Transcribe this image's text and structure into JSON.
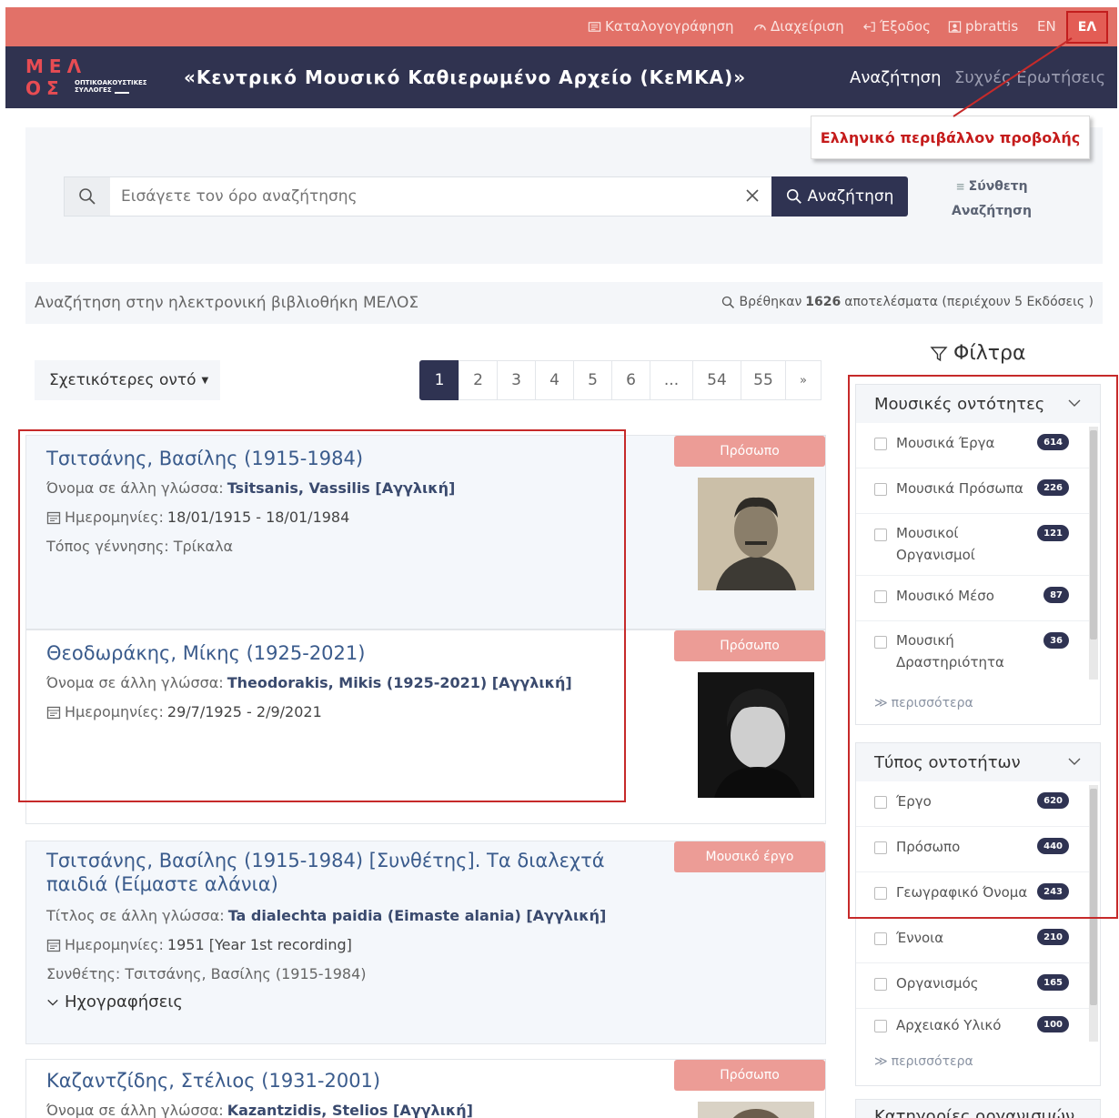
{
  "topbar": {
    "items": [
      {
        "label": "Καταλογογράφηση",
        "icon": "catalog-icon"
      },
      {
        "label": "Διαχείριση",
        "icon": "dashboard-icon"
      },
      {
        "label": "Έξοδος",
        "icon": "logout-icon"
      },
      {
        "label": "pbrattis",
        "icon": "user-icon"
      }
    ],
    "lang_en": "EN",
    "lang_el": "ΕΛ"
  },
  "header": {
    "logo": {
      "letters_top": "ΜΕΛ",
      "letters_bottom": "ΟΣ",
      "subtitle_line1": "ΟΠΤΙΚΟΑΚΟΥΣΤΙΚΕΣ",
      "subtitle_line2": "ΣΥΛΛΟΓΕΣ"
    },
    "title": "«Κεντρικό Μουσικό Καθιερωμένο Αρχείο (ΚεΜΚΑ)»",
    "nav_search": "Αναζήτηση",
    "nav_faq": "Συχνές Ερωτήσεις"
  },
  "callout": "Ελληνικό περιβάλλον προβολής",
  "search": {
    "placeholder": "Εισάγετε τον όρο αναζήτησης",
    "button": "Αναζήτηση",
    "advanced_line1": "Σύνθετη",
    "advanced_line2": "Αναζήτηση"
  },
  "info": {
    "left": "Αναζήτηση στην ηλεκτρονική βιβλιοθήκη ΜΕΛΟΣ",
    "found_prefix": "Βρέθηκαν",
    "found_count": "1626",
    "found_suffix": "αποτελέσματα (περιέχουν 5 Εκδόσεις )"
  },
  "sort": {
    "label": "Σχετικότερες οντό"
  },
  "pagination": {
    "pages": [
      "1",
      "2",
      "3",
      "4",
      "5",
      "6",
      "...",
      "54",
      "55",
      "»"
    ],
    "active": "1"
  },
  "filters": {
    "title": "Φίλτρα",
    "groups": [
      {
        "title": "Μουσικές οντότητες",
        "items": [
          {
            "label": "Μουσικά Έργα",
            "count": "614"
          },
          {
            "label": "Μουσικά Πρόσωπα",
            "count": "226"
          },
          {
            "label": "Μουσικοί Οργανισμοί",
            "count": "121"
          },
          {
            "label": "Μουσικό Μέσο",
            "count": "87"
          },
          {
            "label": "Μουσική Δραστηριότητα",
            "count": "36"
          }
        ],
        "more": "περισσότερα"
      },
      {
        "title": "Τύπος οντοτήτων",
        "items": [
          {
            "label": "Έργο",
            "count": "620"
          },
          {
            "label": "Πρόσωπο",
            "count": "440"
          },
          {
            "label": "Γεωγραφικό Όνομα",
            "count": "243"
          },
          {
            "label": "Έννοια",
            "count": "210"
          },
          {
            "label": "Οργανισμός",
            "count": "165"
          },
          {
            "label": "Αρχειακό Υλικό",
            "count": "100"
          }
        ],
        "more": "περισσότερα"
      },
      {
        "title": "Κατηγορίες οργανισμών"
      }
    ]
  },
  "results": [
    {
      "title": "Τσιτσάνης, Βασίλης (1915-1984)",
      "badge": "Πρόσωπο",
      "other_label": "Όνομα σε άλλη γλώσσα:",
      "other_value": "Tsitsanis, Vassilis [Αγγλική]",
      "dates_label": "Ημερομηνίες:",
      "dates_value": "18/01/1915 - 18/01/1984",
      "birthplace": "Τόπος γέννησης: Τρίκαλα"
    },
    {
      "title": "Θεοδωράκης, Μίκης (1925-2021)",
      "badge": "Πρόσωπο",
      "other_label": "Όνομα σε άλλη γλώσσα:",
      "other_value": "Theodorakis, Mikis (1925-2021) [Αγγλική]",
      "dates_label": "Ημερομηνίες:",
      "dates_value": "29/7/1925 - 2/9/2021"
    },
    {
      "title": "Τσιτσάνης, Βασίλης (1915-1984) [Συνθέτης]. Τα διαλεχτά παιδιά (Είμαστε αλάνια)",
      "badge": "Μουσικό έργο",
      "other_label": "Τίτλος σε άλλη γλώσσα:",
      "other_value": "Ta dialechta paidia (Eimaste alania) [Αγγλική]",
      "dates_label": "Ημερομηνίες:",
      "dates_value": "1951 [Year 1st recording]",
      "composer": "Συνθέτης: Τσιτσάνης, Βασίλης (1915-1984)",
      "expander": "Ηχογραφήσεις"
    },
    {
      "title": "Καζαντζίδης, Στέλιος (1931-2001)",
      "badge": "Πρόσωπο",
      "other_label": "Όνομα σε άλλη γλώσσα:",
      "other_value": "Kazantzidis, Stelios [Αγγλική]"
    }
  ],
  "colors": {
    "topbar": "#e27168",
    "header": "#303350",
    "accent": "#2f3352",
    "badge": "#ec9c96",
    "highlight": "#c62a2a"
  }
}
